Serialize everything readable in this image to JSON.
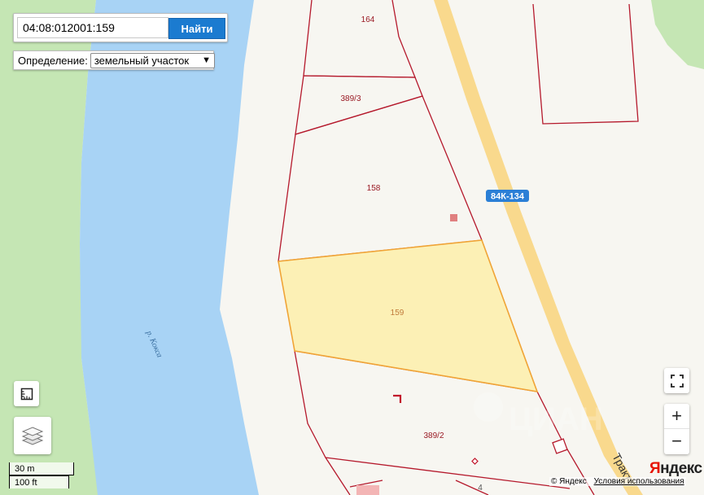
{
  "search": {
    "value": "04:08:012001:159",
    "button_label": "Найти"
  },
  "definition": {
    "label": "Определение:",
    "selected": "земельный участок"
  },
  "map": {
    "parcels": [
      {
        "label": "164"
      },
      {
        "label": "389/3"
      },
      {
        "label": "158"
      },
      {
        "label": "159",
        "selected": true
      },
      {
        "label": "389/2"
      },
      {
        "label": "4"
      }
    ],
    "road_badge": "84К-134",
    "road_name": "Тракт",
    "river_name": "р. Кокса",
    "colors": {
      "river": "#a8d3f5",
      "forest": "#c5e6b4",
      "land": "#f7f6f1",
      "road": "#f9d98d",
      "parcel_border": "#b5192c",
      "selected_fill": "#fcf0b5",
      "selected_border": "#f0a436",
      "badge": "#2b7fd6"
    }
  },
  "scale": {
    "metric": "30 m",
    "imperial": "100 ft"
  },
  "controls": {
    "zoom_in": "+",
    "zoom_out": "−"
  },
  "attribution": {
    "logo_first": "Я",
    "logo_rest": "ндекс",
    "copyright": "© Яндекс",
    "terms": "Условия использования"
  }
}
